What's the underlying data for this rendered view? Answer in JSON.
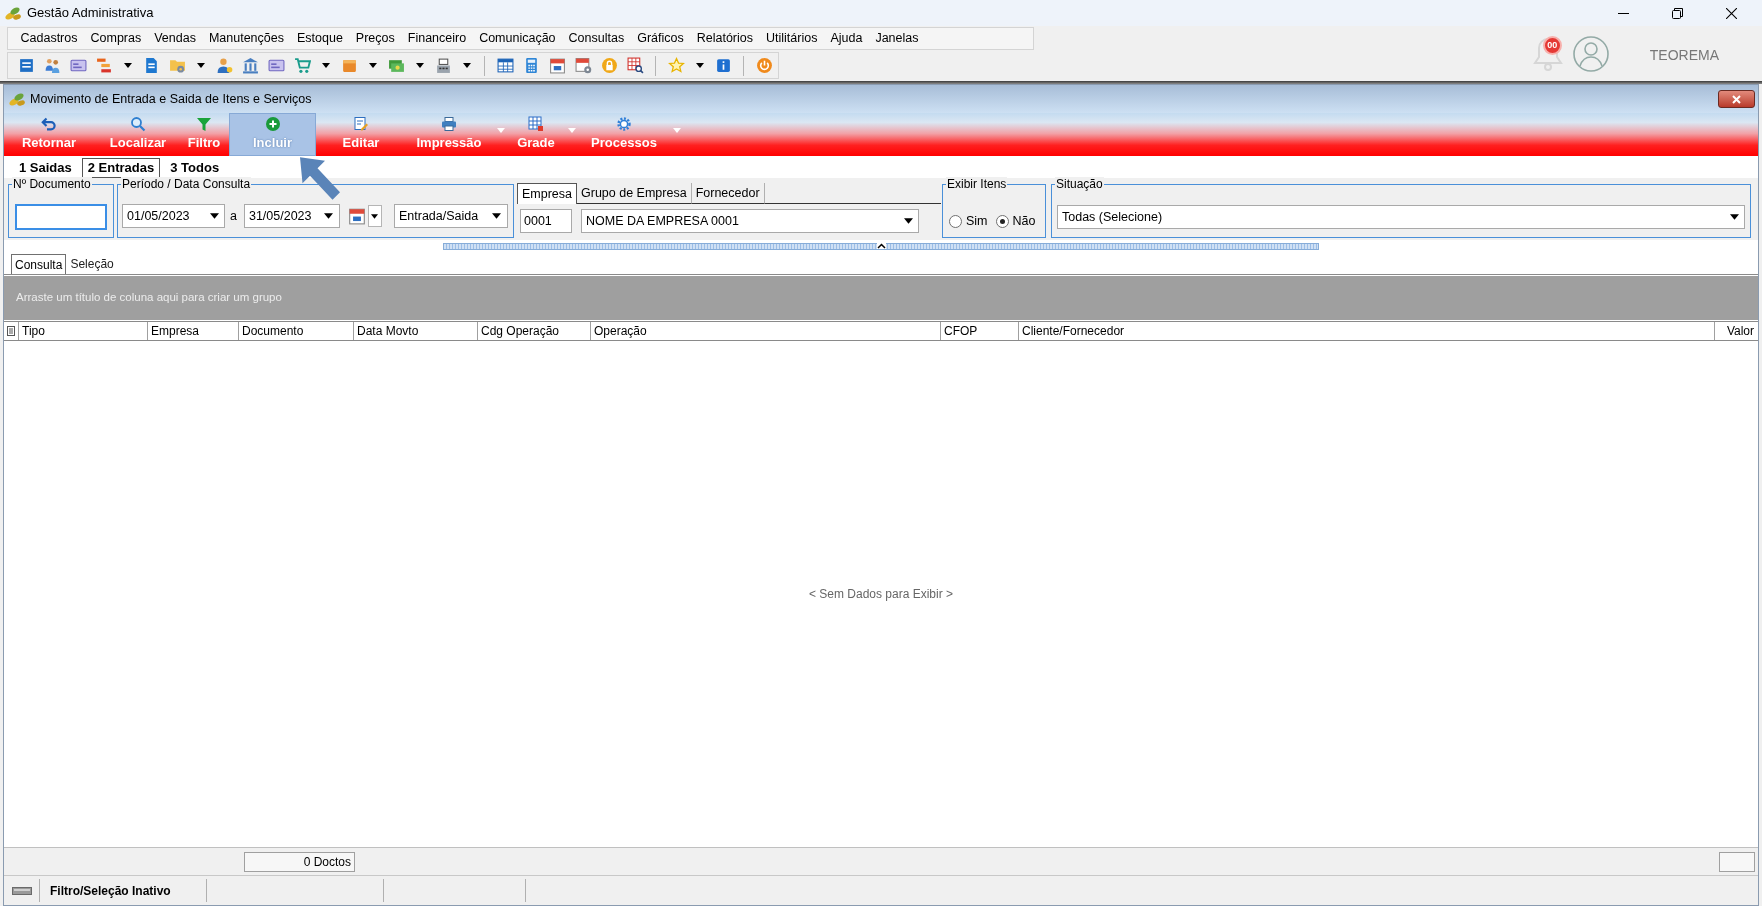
{
  "window": {
    "title": "Gestão Administrativa"
  },
  "menu": [
    "Cadastros",
    "Compras",
    "Vendas",
    "Manutenções",
    "Estoque",
    "Preços",
    "Financeiro",
    "Comunicação",
    "Consultas",
    "Gráficos",
    "Relatórios",
    "Utilitários",
    "Ajuda",
    "Janelas"
  ],
  "account": {
    "notification_count": "00",
    "user": "TEOREMA"
  },
  "child_window": {
    "title": "Movimento de Entrada e Saida de Itens e Serviços"
  },
  "action_bar": [
    {
      "label": "Retornar",
      "selected": false,
      "has_menu": false
    },
    {
      "label": "Localizar",
      "selected": false,
      "has_menu": false
    },
    {
      "label": "Filtro",
      "selected": false,
      "has_menu": false
    },
    {
      "label": "Incluir",
      "selected": true,
      "has_menu": false
    },
    {
      "label": "Editar",
      "selected": false,
      "has_menu": false
    },
    {
      "label": "Impressão",
      "selected": false,
      "has_menu": true
    },
    {
      "label": "Grade",
      "selected": false,
      "has_menu": true
    },
    {
      "label": "Processos",
      "selected": false,
      "has_menu": true
    }
  ],
  "mode_tabs": [
    {
      "label": "1 Saidas",
      "selected": false
    },
    {
      "label": "2 Entradas",
      "selected": true
    },
    {
      "label": "3 Todos",
      "selected": false
    }
  ],
  "filters": {
    "document": {
      "legend": "Nº Documento",
      "focused": true
    },
    "period": {
      "legend": "Período / Data Consulta",
      "from": "01/05/2023",
      "separator": "a",
      "to": "31/05/2023",
      "movement": "Entrada/Saida"
    },
    "company": {
      "tabs": [
        {
          "label": "Empresa",
          "selected": true
        },
        {
          "label": "Grupo de Empresa",
          "selected": false
        },
        {
          "label": "Fornecedor",
          "selected": false
        }
      ],
      "code": "0001",
      "name": "NOME DA EMPRESA 0001"
    },
    "show_items": {
      "legend": "Exibir Itens",
      "options": [
        {
          "label": "Sim",
          "selected": false
        },
        {
          "label": "Não",
          "selected": true
        }
      ]
    },
    "situation": {
      "legend": "Situação",
      "value": "Todas (Selecione)"
    }
  },
  "view_tabs": [
    {
      "label": "Consulta",
      "selected": true
    },
    {
      "label": "Seleção",
      "selected": false
    }
  ],
  "grid": {
    "group_hint": "Arraste um título de coluna aqui para criar um grupo",
    "columns": [
      "Tipo",
      "Empresa",
      "Documento",
      "Data Movto",
      "Cdg Operação",
      "Operação",
      "CFOP",
      "Cliente/Fornecedor",
      "Valor"
    ],
    "empty_text": "< Sem Dados para Exibir >",
    "footer_count": "0 Doctos"
  },
  "status_bar": {
    "filter_state": "Filtro/Seleção Inativo"
  }
}
